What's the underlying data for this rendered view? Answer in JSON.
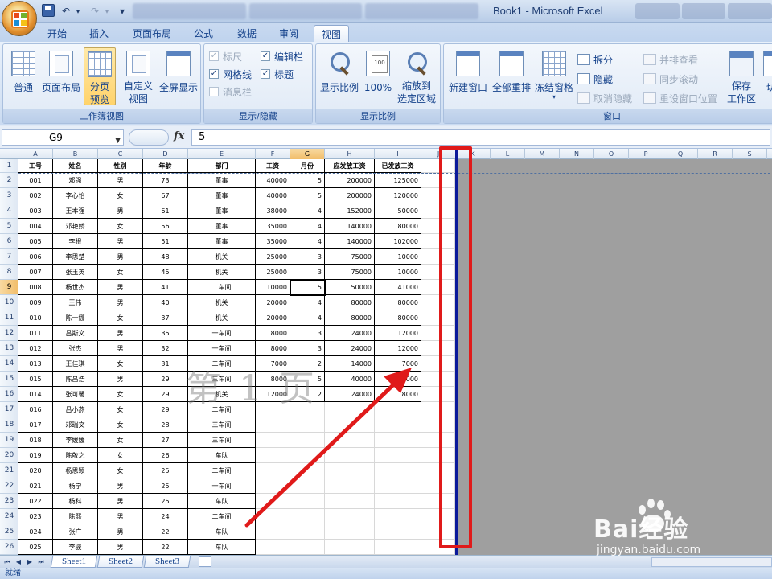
{
  "app": {
    "window_title": "Book1 - Microsoft Excel"
  },
  "ribbon_tabs": [
    "开始",
    "插入",
    "页面布局",
    "公式",
    "数据",
    "审阅",
    "视图"
  ],
  "active_tab": "视图",
  "ribbon": {
    "workbook_views": {
      "label": "工作簿视图",
      "buttons": [
        "普通",
        "页面布局",
        "分页\n预览",
        "自定义\n视图",
        "全屏显示"
      ]
    },
    "show_hide": {
      "label": "显示/隐藏",
      "checks": [
        {
          "label": "标尺",
          "checked": true,
          "disabled": true
        },
        {
          "label": "编辑栏",
          "checked": true,
          "disabled": false
        },
        {
          "label": "网格线",
          "checked": true,
          "disabled": false
        },
        {
          "label": "标题",
          "checked": true,
          "disabled": false
        },
        {
          "label": "消息栏",
          "checked": false,
          "disabled": true
        }
      ]
    },
    "zoom": {
      "label": "显示比例",
      "buttons": [
        "显示比例",
        "100%",
        "缩放到\n选定区域"
      ]
    },
    "window": {
      "label": "窗口",
      "big_buttons": [
        "新建窗口",
        "全部重排",
        "冻结窗格",
        "保存\n工作区",
        "切"
      ],
      "small_buttons": [
        {
          "label": "拆分",
          "disabled": false
        },
        {
          "label": "隐藏",
          "disabled": false
        },
        {
          "label": "取消隐藏",
          "disabled": true
        },
        {
          "label": "并排查看",
          "disabled": true
        },
        {
          "label": "同步滚动",
          "disabled": true
        },
        {
          "label": "重设窗口位置",
          "disabled": true
        }
      ]
    }
  },
  "formula_bar": {
    "name_box": "G9",
    "fx_label": "fx",
    "value": "5"
  },
  "columns": [
    "A",
    "B",
    "C",
    "D",
    "E",
    "F",
    "G",
    "H",
    "I",
    "J",
    "K",
    "L",
    "M",
    "N",
    "O",
    "P",
    "Q",
    "R",
    "S"
  ],
  "headers": [
    "工号",
    "姓名",
    "性别",
    "年龄",
    "部门",
    "工资",
    "月份",
    "应发放工资",
    "已发放工资"
  ],
  "rows": [
    [
      "001",
      "邓强",
      "男",
      "73",
      "董事",
      "40000",
      "5",
      "200000",
      "125000"
    ],
    [
      "002",
      "李心怡",
      "女",
      "67",
      "董事",
      "40000",
      "5",
      "200000",
      "120000"
    ],
    [
      "003",
      "王本强",
      "男",
      "61",
      "董事",
      "38000",
      "4",
      "152000",
      "50000"
    ],
    [
      "004",
      "邓艳娇",
      "女",
      "56",
      "董事",
      "35000",
      "4",
      "140000",
      "80000"
    ],
    [
      "005",
      "李根",
      "男",
      "51",
      "董事",
      "35000",
      "4",
      "140000",
      "102000"
    ],
    [
      "006",
      "李思楚",
      "男",
      "48",
      "机关",
      "25000",
      "3",
      "75000",
      "10000"
    ],
    [
      "007",
      "张玉英",
      "女",
      "45",
      "机关",
      "25000",
      "3",
      "75000",
      "10000"
    ],
    [
      "008",
      "杨世杰",
      "男",
      "41",
      "二车间",
      "10000",
      "5",
      "50000",
      "41000"
    ],
    [
      "009",
      "王伟",
      "男",
      "40",
      "机关",
      "20000",
      "4",
      "80000",
      "80000"
    ],
    [
      "010",
      "陈一娜",
      "女",
      "37",
      "机关",
      "20000",
      "4",
      "80000",
      "80000"
    ],
    [
      "011",
      "吕斯文",
      "男",
      "35",
      "一车间",
      "8000",
      "3",
      "24000",
      "12000"
    ],
    [
      "012",
      "张杰",
      "男",
      "32",
      "一车间",
      "8000",
      "3",
      "24000",
      "12000"
    ],
    [
      "013",
      "王佳琪",
      "女",
      "31",
      "二车间",
      "7000",
      "2",
      "14000",
      "7000"
    ],
    [
      "015",
      "陈昌浩",
      "男",
      "29",
      "三车间",
      "8000",
      "5",
      "40000",
      "32000"
    ],
    [
      "014",
      "张可馨",
      "女",
      "29",
      "机关",
      "12000",
      "2",
      "24000",
      "8000"
    ],
    [
      "016",
      "吕小燕",
      "女",
      "29",
      "二车间",
      "",
      "",
      "",
      ""
    ],
    [
      "017",
      "邓瑞文",
      "女",
      "28",
      "三车间",
      "",
      "",
      "",
      ""
    ],
    [
      "018",
      "李媛媛",
      "女",
      "27",
      "三车间",
      "",
      "",
      "",
      ""
    ],
    [
      "019",
      "陈敬之",
      "女",
      "26",
      "车队",
      "",
      "",
      "",
      ""
    ],
    [
      "020",
      "杨思颖",
      "女",
      "25",
      "二车间",
      "",
      "",
      "",
      ""
    ],
    [
      "021",
      "杨宁",
      "男",
      "25",
      "一车间",
      "",
      "",
      "",
      ""
    ],
    [
      "022",
      "杨科",
      "男",
      "25",
      "车队",
      "",
      "",
      "",
      ""
    ],
    [
      "023",
      "陈熙",
      "男",
      "24",
      "二车间",
      "",
      "",
      "",
      ""
    ],
    [
      "024",
      "张广",
      "男",
      "22",
      "车队",
      "",
      "",
      "",
      ""
    ],
    [
      "025",
      "李骏",
      "男",
      "22",
      "车队",
      "",
      "",
      "",
      ""
    ]
  ],
  "row_numbers": [
    "1",
    "2",
    "3",
    "4",
    "5",
    "6",
    "7",
    "8",
    "9",
    "10",
    "11",
    "12",
    "13",
    "14",
    "15",
    "16",
    "17",
    "18",
    "19",
    "20",
    "21",
    "22",
    "23",
    "24",
    "25",
    "26"
  ],
  "selected": {
    "col": "G",
    "row": "9"
  },
  "page_watermark": "第 1 页",
  "sheet_tabs": [
    "Sheet1",
    "Sheet2",
    "Sheet3"
  ],
  "status": "就绪",
  "watermark_brand": {
    "main": "Bai经验",
    "sub": "jingyan.baidu.com"
  },
  "colors": {
    "annotation": "#e01a1a",
    "page_break": "#0b1a9a",
    "ribbon_text": "#15428b"
  }
}
